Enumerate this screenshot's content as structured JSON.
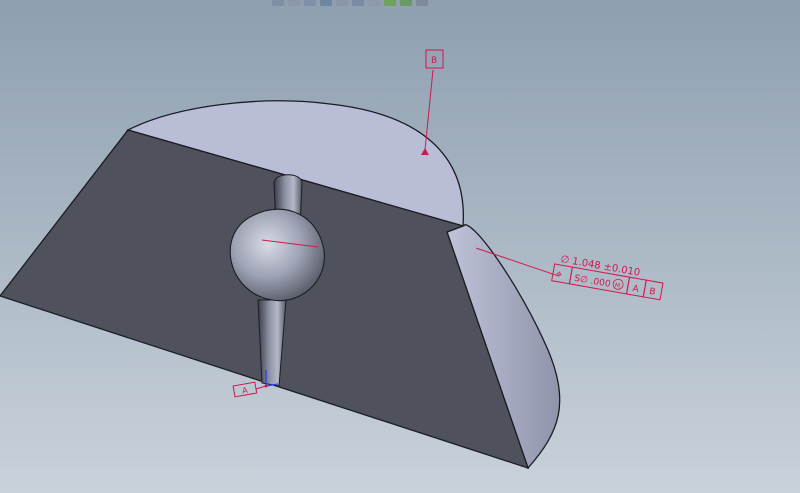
{
  "viewport": {
    "background_top": "#8f9fb0",
    "background_bottom": "#c9d2db"
  },
  "toolbar": {
    "icons": [
      "zoom-icon",
      "rotate-icon",
      "pan-icon",
      "view-orientation-icon",
      "section-view-icon",
      "display-style-icon",
      "hide-show-icon",
      "edit-appearance-icon",
      "scene-icon",
      "display-icon"
    ]
  },
  "annotations": {
    "datum_b_label": "B",
    "datum_a_label": "A",
    "diameter_text": "∅ 1.048 ±0.010",
    "fcf": {
      "symbol": "⌖",
      "tolerance": "S∅ .000",
      "modifier": "M",
      "datum_1": "A",
      "datum_2": "B"
    }
  },
  "colors": {
    "annotation": "#d0174f",
    "model_front": "#4f525d",
    "model_top": "#b9bdd6",
    "model_side": "#a4a9c0"
  }
}
